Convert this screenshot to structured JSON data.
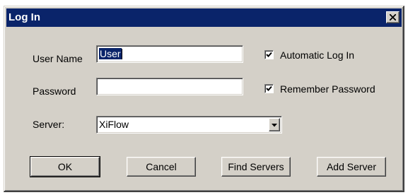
{
  "window": {
    "title": "Log In",
    "close_label": "×"
  },
  "form": {
    "user_name_label": "User Name",
    "user_name_value": "User",
    "password_label": "Password",
    "password_value": "",
    "server_label": "Server:",
    "server_value": "XiFlow",
    "automatic_login_label": "Automatic Log In",
    "automatic_login_checked": true,
    "remember_password_label": "Remember Password",
    "remember_password_checked": true
  },
  "buttons": {
    "ok": "OK",
    "cancel": "Cancel",
    "find_servers": "Find Servers",
    "add_server": "Add Server"
  },
  "colors": {
    "titlebar": "#0a246a",
    "face": "#d4d0c8",
    "selection": "#0a246a"
  },
  "icons": {
    "close": "close-icon",
    "checkmark": "checkmark-icon",
    "dropdown": "chevron-down-icon"
  }
}
